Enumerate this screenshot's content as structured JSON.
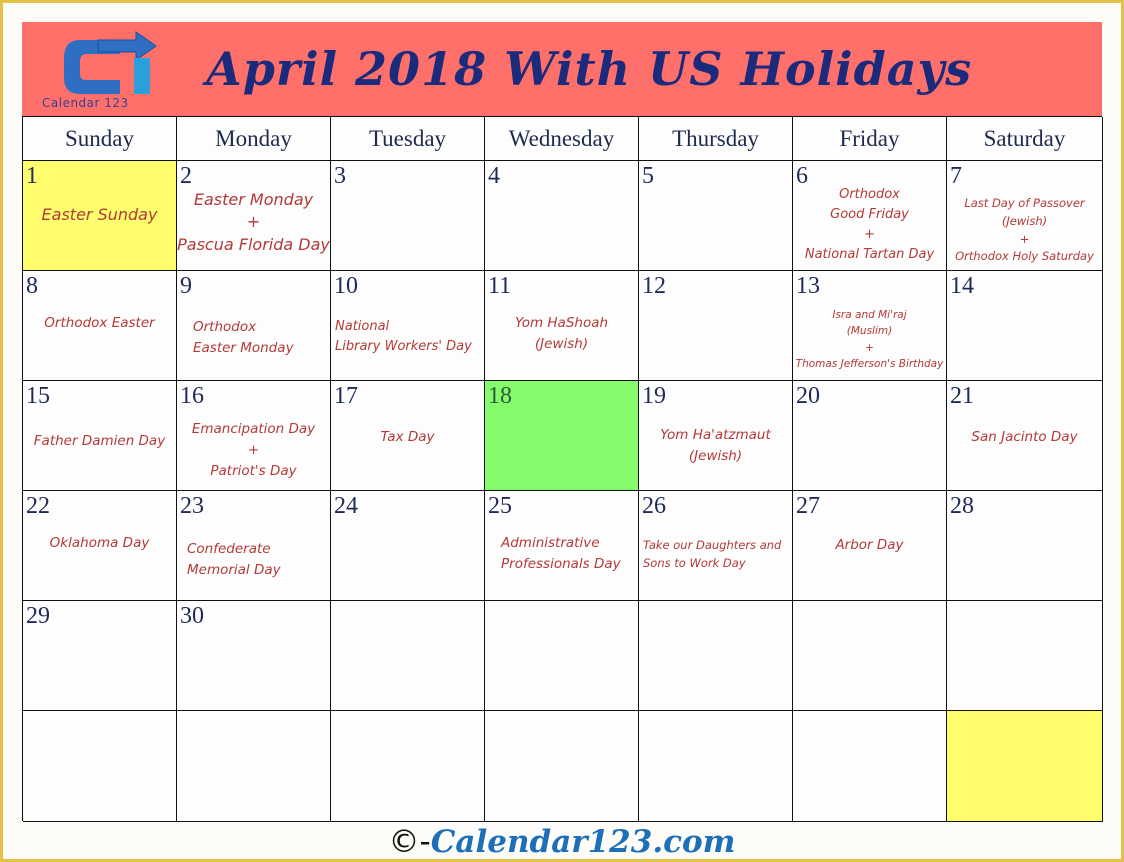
{
  "header": {
    "logo_text": "Calendar 123",
    "title": "April 2018 With US Holidays"
  },
  "colors": {
    "header_bg": "#ff706b",
    "title_color": "#1c2a7c",
    "holiday_text": "#b33a36",
    "highlight_yellow": "#ffff6e",
    "highlight_green": "#86fb6c",
    "frame": "#e3c24a"
  },
  "weekdays": [
    "Sunday",
    "Monday",
    "Tuesday",
    "Wednesday",
    "Thursday",
    "Friday",
    "Saturday"
  ],
  "days": {
    "d1": {
      "num": "1",
      "holiday": "Easter Sunday"
    },
    "d2": {
      "num": "2",
      "holiday": "Easter Monday\n+\nPascua Florida Day"
    },
    "d3": {
      "num": "3"
    },
    "d4": {
      "num": "4"
    },
    "d5": {
      "num": "5"
    },
    "d6": {
      "num": "6",
      "holiday": "Orthodox\nGood Friday\n+\nNational Tartan Day"
    },
    "d7": {
      "num": "7",
      "holiday": "Last Day of Passover\n(Jewish)\n+\nOrthodox Holy Saturday"
    },
    "d8": {
      "num": "8",
      "holiday": "Orthodox Easter"
    },
    "d9": {
      "num": "9",
      "holiday": "Orthodox\nEaster Monday"
    },
    "d10": {
      "num": "10",
      "holiday": "National\nLibrary Workers' Day"
    },
    "d11": {
      "num": "11",
      "holiday": "Yom HaShoah\n(Jewish)"
    },
    "d12": {
      "num": "12"
    },
    "d13": {
      "num": "13",
      "holiday": "Isra and Mi'raj\n(Muslim)\n+\nThomas Jefferson's Birthday"
    },
    "d14": {
      "num": "14"
    },
    "d15": {
      "num": "15",
      "holiday": "Father Damien Day"
    },
    "d16": {
      "num": "16",
      "holiday": "Emancipation Day\n+\nPatriot's Day"
    },
    "d17": {
      "num": "17",
      "holiday": "Tax Day"
    },
    "d18": {
      "num": "18"
    },
    "d19": {
      "num": "19",
      "holiday": "Yom Ha'atzmaut\n(Jewish)"
    },
    "d20": {
      "num": "20"
    },
    "d21": {
      "num": "21",
      "holiday": "San Jacinto Day"
    },
    "d22": {
      "num": "22",
      "holiday": "Oklahoma Day"
    },
    "d23": {
      "num": "23",
      "holiday": "Confederate\nMemorial Day"
    },
    "d24": {
      "num": "24"
    },
    "d25": {
      "num": "25",
      "holiday": "Administrative\nProfessionals Day"
    },
    "d26": {
      "num": "26",
      "holiday": "Take our Daughters and\nSons to Work Day"
    },
    "d27": {
      "num": "27",
      "holiday": "Arbor Day"
    },
    "d28": {
      "num": "28"
    },
    "d29": {
      "num": "29"
    },
    "d30": {
      "num": "30"
    }
  },
  "footer": {
    "copyright": "©-",
    "site": "Calendar123.com"
  }
}
